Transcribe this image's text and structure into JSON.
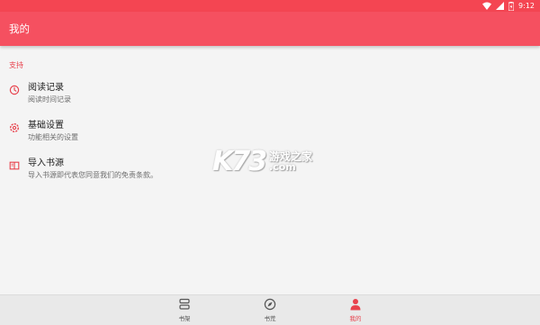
{
  "status": {
    "time": "9:12"
  },
  "header": {
    "title": "我的"
  },
  "section": {
    "title": "支持"
  },
  "items": [
    {
      "title": "阅读记录",
      "subtitle": "阅读时间记录",
      "icon": "clock-icon"
    },
    {
      "title": "基础设置",
      "subtitle": "功能相关的设置",
      "icon": "settings-icon"
    },
    {
      "title": "导入书源",
      "subtitle": "导入书源即代表您同意我们的免责条款。",
      "icon": "book-icon"
    }
  ],
  "watermark": {
    "logo": "K73",
    "cn": "游戏之家",
    "com": ".com"
  },
  "nav": [
    {
      "label": "书架",
      "icon": "bookshelf-icon",
      "active": false
    },
    {
      "label": "书荒",
      "icon": "compass-icon",
      "active": false
    },
    {
      "label": "我的",
      "icon": "person-icon",
      "active": true
    }
  ],
  "colors": {
    "primary": "#f55060",
    "accent": "#e8424d",
    "background": "#f4f4f4"
  }
}
